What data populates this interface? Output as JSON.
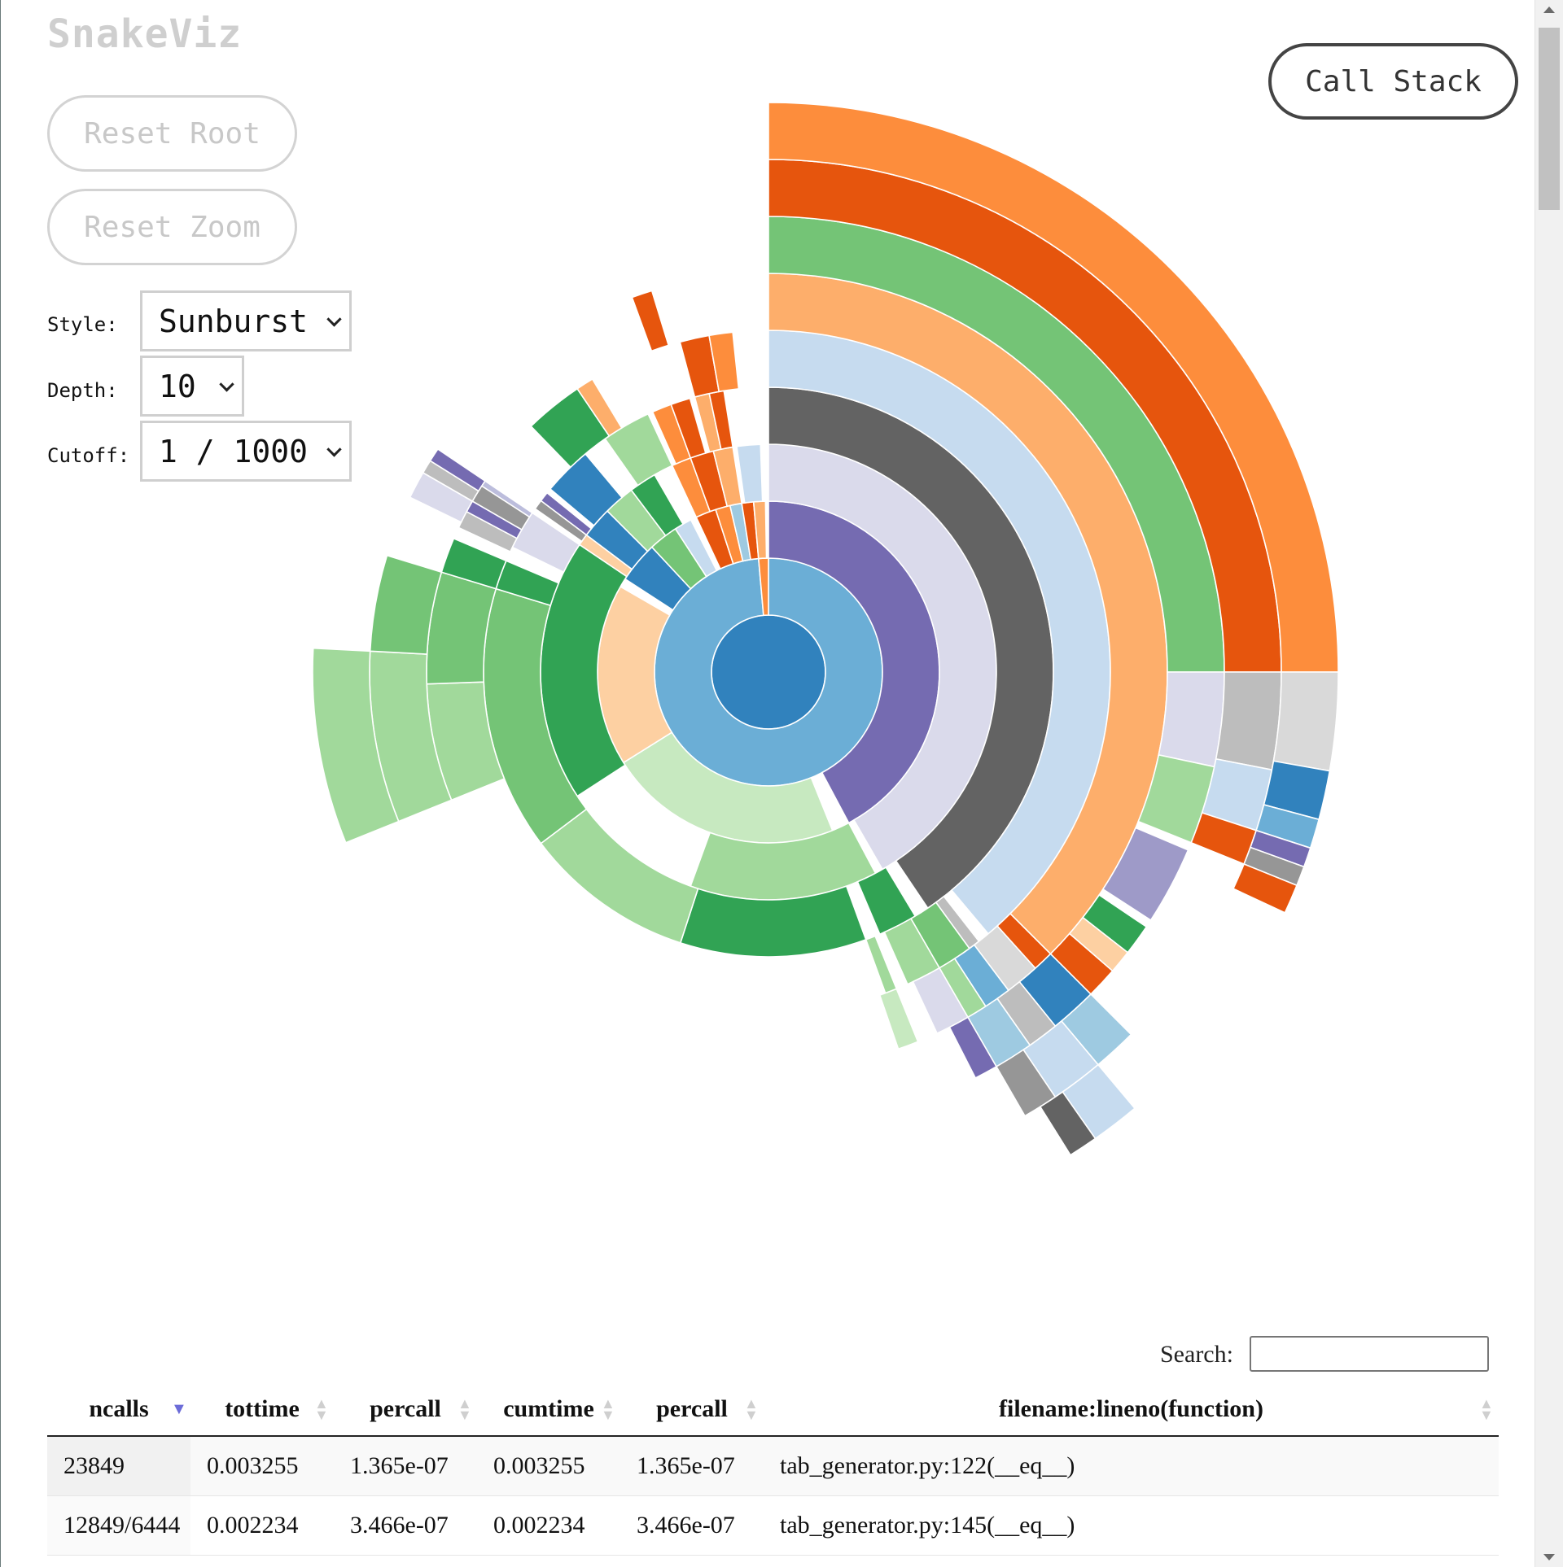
{
  "app": {
    "title": "SnakeViz"
  },
  "buttons": {
    "reset_root": "Reset Root",
    "reset_zoom": "Reset Zoom",
    "call_stack": "Call Stack"
  },
  "controls": {
    "style_label": "Style:",
    "style_value": "Sunburst",
    "depth_label": "Depth:",
    "depth_value": "10",
    "cutoff_label": "Cutoff:",
    "cutoff_value": "1 / 1000"
  },
  "search": {
    "label": "Search:",
    "value": ""
  },
  "table": {
    "sort_column": "ncalls",
    "sort_direction": "descending",
    "headers": [
      "ncalls",
      "tottime",
      "percall",
      "cumtime",
      "percall",
      "filename:lineno(function)"
    ],
    "rows": [
      [
        "23849",
        "0.003255",
        "1.365e-07",
        "0.003255",
        "1.365e-07",
        "tab_generator.py:122(__eq__)"
      ],
      [
        "12849/6444",
        "0.002234",
        "3.466e-07",
        "0.002234",
        "3.466e-07",
        "tab_generator.py:145(__eq__)"
      ]
    ]
  },
  "sunburst_colors": {
    "blue_dark": "#3182bd",
    "blue_mid": "#6baed6",
    "blue_light": "#9ecae1",
    "blue_pale": "#c6dbef",
    "orange_dark": "#e6550d",
    "orange_mid": "#fd8d3c",
    "orange_light": "#fdae6b",
    "orange_pale": "#fdd0a2",
    "green_dark": "#31a354",
    "green_mid": "#74c476",
    "green_light": "#a1d99b",
    "green_pale": "#c7e9c0",
    "purple_dark": "#756bb1",
    "purple_mid": "#9e9ac8",
    "purple_light": "#bcbddc",
    "purple_pale": "#dadaeb",
    "gray_dark": "#636363",
    "gray_mid": "#969696",
    "gray_light": "#bdbdbd",
    "gray_pale": "#d9d9d9"
  }
}
